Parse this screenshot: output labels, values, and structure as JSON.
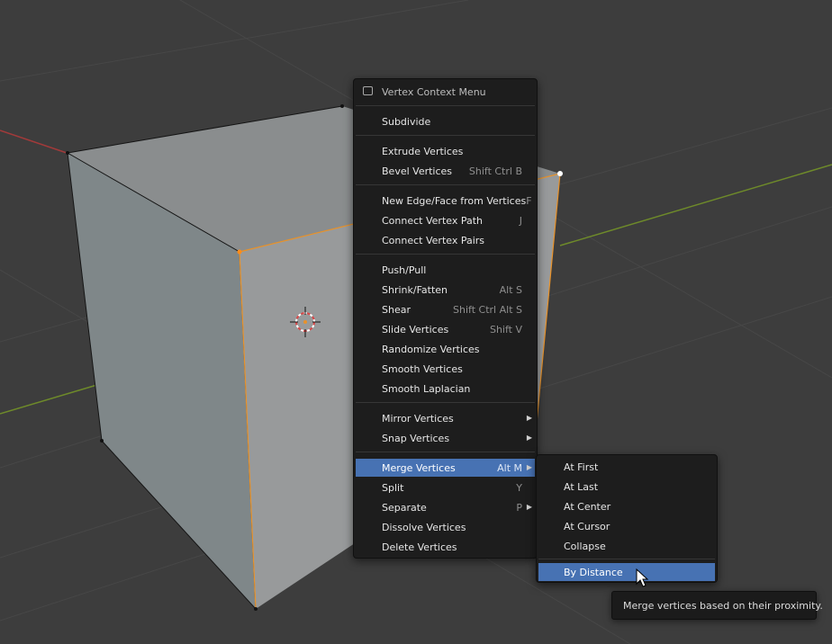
{
  "context_menu": {
    "title": "Vertex Context Menu",
    "items": [
      {
        "label": "Subdivide",
        "shortcut": ""
      },
      {
        "label": "Extrude Vertices",
        "shortcut": ""
      },
      {
        "label": "Bevel Vertices",
        "shortcut": "Shift Ctrl B"
      },
      {
        "label": "New Edge/Face from Vertices",
        "shortcut": "F"
      },
      {
        "label": "Connect Vertex Path",
        "shortcut": "J"
      },
      {
        "label": "Connect Vertex Pairs",
        "shortcut": ""
      },
      {
        "label": "Push/Pull",
        "shortcut": ""
      },
      {
        "label": "Shrink/Fatten",
        "shortcut": "Alt S"
      },
      {
        "label": "Shear",
        "shortcut": "Shift Ctrl Alt S"
      },
      {
        "label": "Slide Vertices",
        "shortcut": "Shift V"
      },
      {
        "label": "Randomize Vertices",
        "shortcut": ""
      },
      {
        "label": "Smooth Vertices",
        "shortcut": ""
      },
      {
        "label": "Smooth Laplacian",
        "shortcut": ""
      },
      {
        "label": "Mirror Vertices",
        "shortcut": ""
      },
      {
        "label": "Snap Vertices",
        "shortcut": ""
      },
      {
        "label": "Merge Vertices",
        "shortcut": "Alt M"
      },
      {
        "label": "Split",
        "shortcut": "Y"
      },
      {
        "label": "Separate",
        "shortcut": "P"
      },
      {
        "label": "Dissolve Vertices",
        "shortcut": ""
      },
      {
        "label": "Delete Vertices",
        "shortcut": ""
      }
    ]
  },
  "merge_submenu": {
    "items": [
      {
        "label": "At First"
      },
      {
        "label": "At Last"
      },
      {
        "label": "At Center"
      },
      {
        "label": "At Cursor"
      },
      {
        "label": "Collapse"
      },
      {
        "label": "By Distance"
      }
    ]
  },
  "tooltip": {
    "text": "Merge vertices based on their proximity."
  },
  "colors": {
    "highlight": "#4772b3",
    "menu_bg": "#1d1d1d",
    "selected_edge": "#e8922a"
  }
}
